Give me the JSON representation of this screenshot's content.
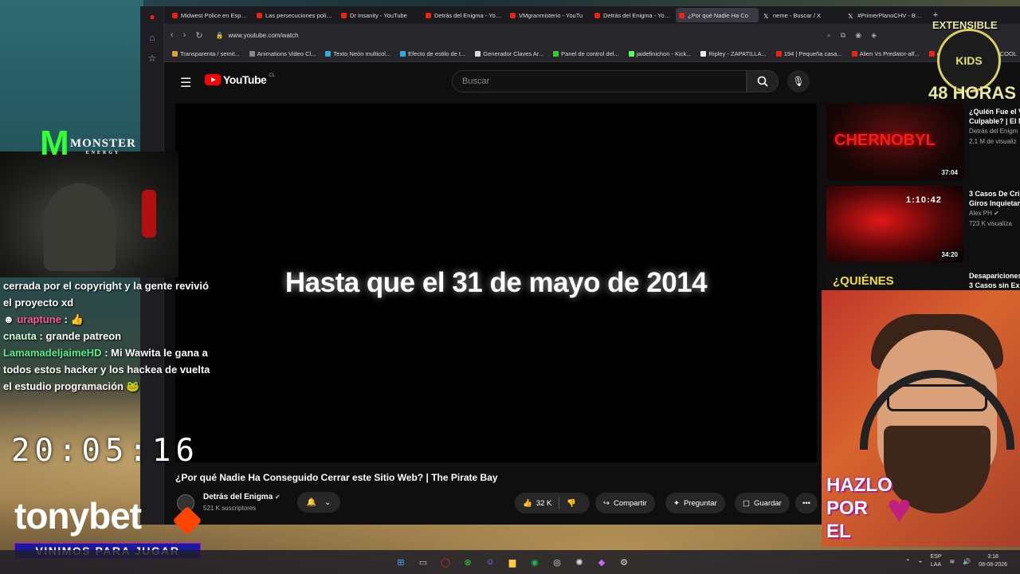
{
  "browser": {
    "tabs": [
      {
        "label": "Midwest Police en Españo",
        "icon": "youtube-icon"
      },
      {
        "label": "Las persecuciones policial",
        "icon": "youtube-icon"
      },
      {
        "label": "Dr Insanity - YouTube",
        "icon": "youtube-icon"
      },
      {
        "label": "Detrás del Enigma - YouTu",
        "icon": "youtube-icon"
      },
      {
        "label": "VMgranmisterio - YouTu",
        "icon": "youtube-icon"
      },
      {
        "label": "Detrás del Enigma - YouTu",
        "icon": "youtube-icon"
      },
      {
        "label": "¿Por qué Nadie Ha Co",
        "icon": "youtube-icon",
        "active": true
      },
      {
        "label": "neme - Buscar / X",
        "icon": "x-icon"
      },
      {
        "label": "#PrimerPlanoCHV - Busca",
        "icon": "x-icon"
      }
    ],
    "url": "www.youtube.com/watch",
    "bookmarks": [
      "Transparenta / semit...",
      "Animations Video Cl...",
      "Texto Neón multicol...",
      "Efecto de estilo de t...",
      "Generador Claves Ar...",
      "Panel de control del...",
      "jaidefinichon - Kick...",
      "Ripley - ZAPATILLA...",
      "194 | Pequeña casa...",
      "Alien Vs Predator-alf...",
      "cre",
      "COOL"
    ]
  },
  "youtube": {
    "logo_text": "YouTube",
    "region": "CL",
    "search_placeholder": "Buscar",
    "video_caption": "Hasta que el 31 de mayo de 2014",
    "video_title": "¿Por qué Nadie Ha Conseguido Cerrar este Sitio Web? | The Pirate Bay",
    "channel_name": "Detrás del Enigma",
    "subscribers": "521 K suscriptores",
    "likes": "32 K",
    "share_label": "Compartir",
    "ask_label": "Preguntar",
    "save_label": "Guardar",
    "recommendations": [
      {
        "title_l1": "¿Quién Fue el V",
        "title_l2": "Culpable? | El M",
        "channel": "Detrás del Enigm",
        "views": "2,1 M de visualiz",
        "duration": "37:04",
        "thumb_text": "CHERNOBYL"
      },
      {
        "title_l1": "3 Casos De Cri",
        "title_l2": "Giros Inquietan",
        "channel": "Alex PH",
        "views": "723 K visualiza",
        "duration": "34:20",
        "thumb_text": "1:10:42"
      },
      {
        "title_l1": "Desapariciones",
        "title_l2": "3 Casos sin Exp",
        "thumb_text": "¿QUIÉNES"
      }
    ]
  },
  "overlay": {
    "chat": [
      {
        "user": "",
        "text": "cerrada por el copyright y la gente revivió el proyecto xd"
      },
      {
        "user": "uraptune",
        "text": ":"
      },
      {
        "user": "cnauta",
        "text": ": grande patreon"
      },
      {
        "user": "LamamadeljaimeHD",
        "text": ": Mi Wawita le gana a todos estos hacker y los hackea de vuelta el estudio programación"
      }
    ],
    "clock": "20:05:16",
    "sponsor": "tonybet",
    "sponsor_tagline": "VINIMOS PARA JUGAR",
    "monster_brand": "MONSTER",
    "monster_sub": "ENERGY",
    "badge_top": "EXTENSIBLE",
    "badge_kids": "KIDS",
    "badge_bottom": "48 HORAS",
    "hazlo_l1": "HAZLO",
    "hazlo_l2": "POR",
    "hazlo_l3": "EL"
  },
  "taskbar": {
    "lang": "ESP",
    "lang2": "LAA",
    "time": "3:18",
    "date": "08-08-2026"
  }
}
